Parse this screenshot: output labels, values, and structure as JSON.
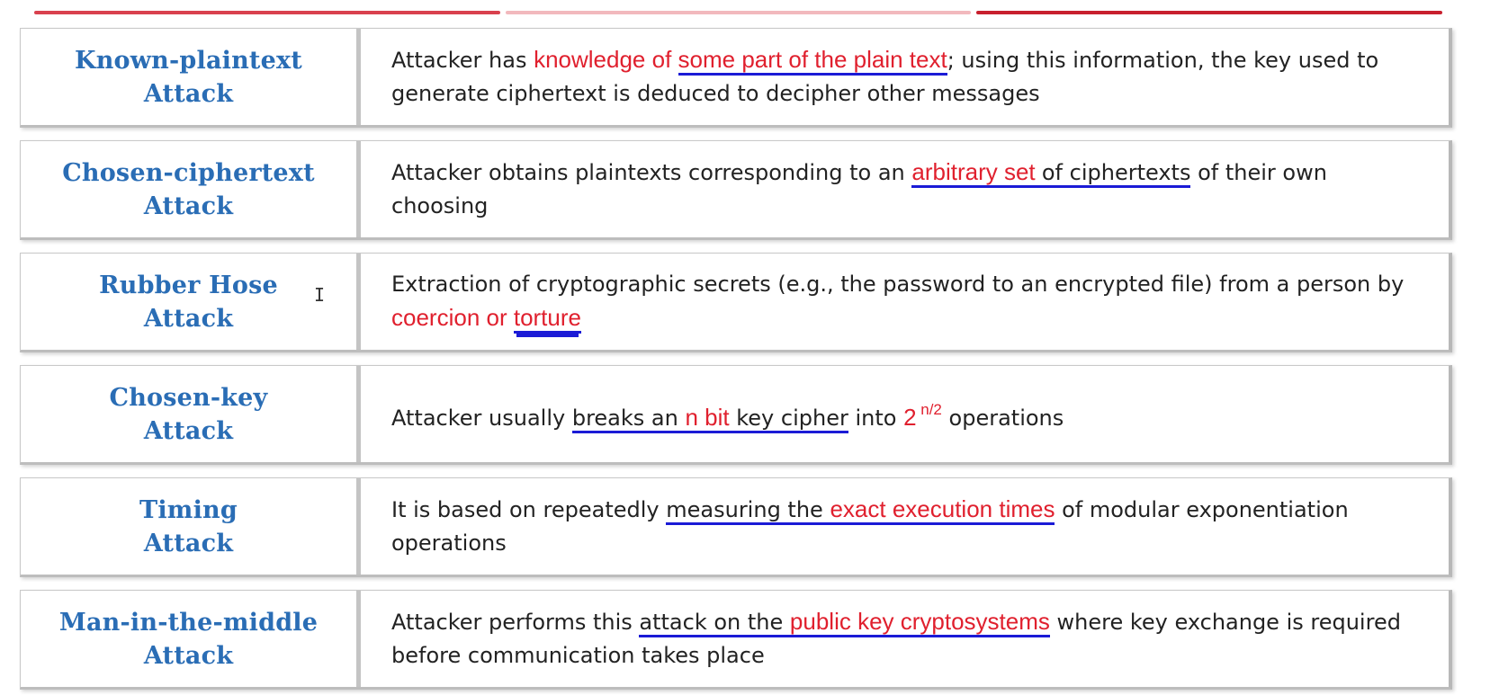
{
  "rows": [
    {
      "title_line1": "Known-plaintext",
      "title_line2": "Attack",
      "desc": {
        "p1": "Attacker has ",
        "h1": "knowledge of ",
        "h2": "some part of the plain text",
        "p2": "; using this information, the key used to generate ciphertext is deduced to decipher other messages"
      }
    },
    {
      "title_line1": "Chosen-ciphertext",
      "title_line2": "Attack",
      "desc": {
        "p1": "Attacker obtains plaintexts corresponding to an ",
        "h1": "arbitrary set ",
        "u1": "of ciphertexts",
        "p2": " of their own choosing"
      }
    },
    {
      "title_line1": "Rubber Hose",
      "title_line2": "Attack",
      "desc": {
        "p1": "Extraction of cryptographic secrets (e.g., the password to an encrypted file) from a person by ",
        "h1": "coercion or ",
        "h2": "torture"
      }
    },
    {
      "title_line1": "Chosen-key",
      "title_line2": "Attack",
      "desc": {
        "p1": "Attacker usually ",
        "u1": "breaks an ",
        "h1": "n bit",
        "u2": " key cipher",
        "p2": " into ",
        "h2": "2",
        "sup": " n/2",
        "p3": " operations"
      }
    },
    {
      "title_line1": "Timing",
      "title_line2": "Attack",
      "desc": {
        "p1": "It is based on repeatedly ",
        "u1": "measuring the ",
        "h1": "exact execution times",
        "p2": " of modular exponentiation operations"
      }
    },
    {
      "title_line1": "Man-in-the-middle",
      "title_line2": "Attack",
      "desc": {
        "p1": "Attacker performs this ",
        "u1": "attack on the ",
        "h1": "public key cryptosystems",
        "p2": " where key exchange is required before communication takes place"
      }
    }
  ],
  "colors": {
    "title": "#2a6db5",
    "highlight": "#e0202e",
    "underline": "#1b1bd6",
    "body_text": "#222222",
    "top_rule": "#d9414e"
  },
  "cursor_glyph": "I"
}
